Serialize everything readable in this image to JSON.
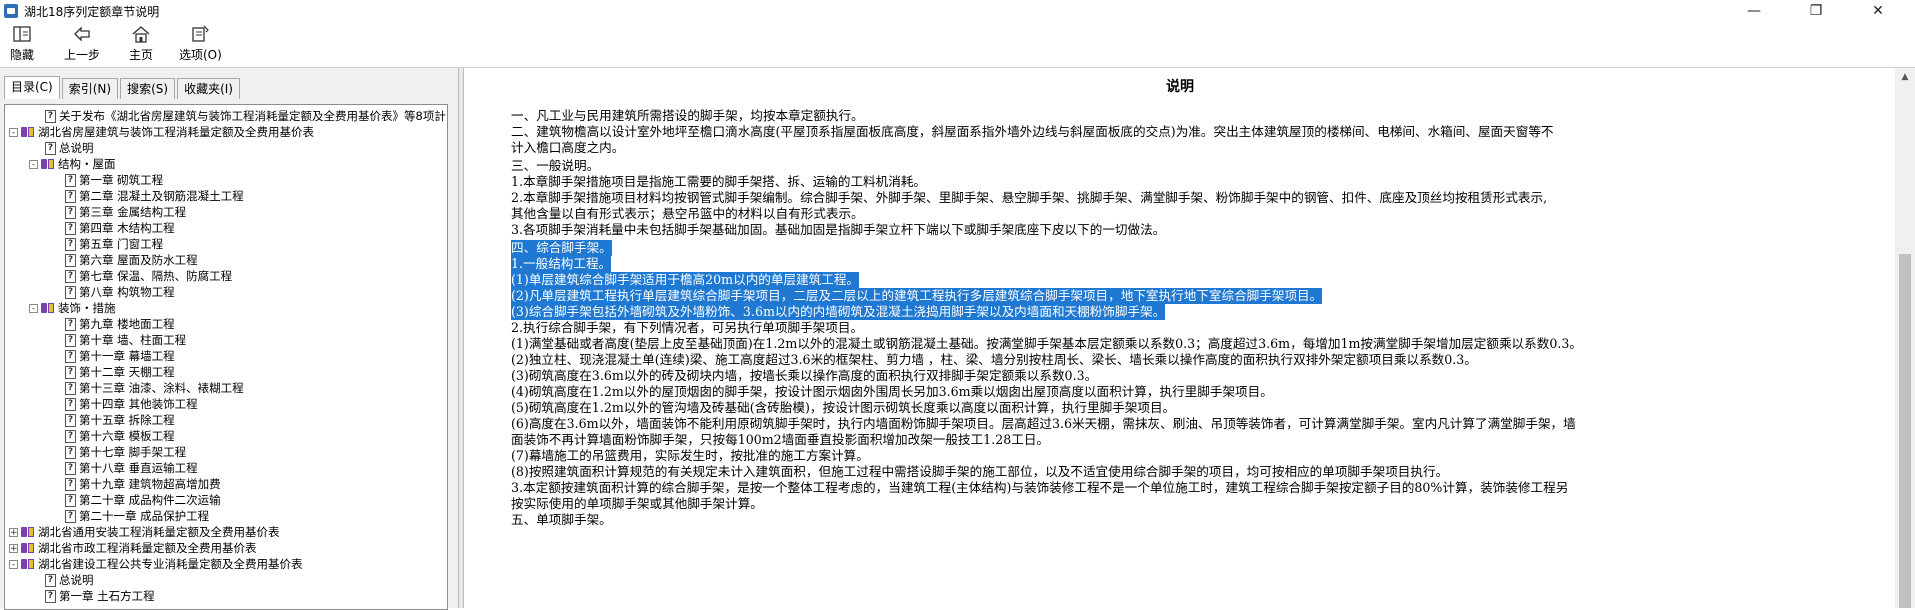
{
  "window": {
    "title": "湖北18序列定额章节说明"
  },
  "toolbar": {
    "buttons": [
      {
        "label": "隐藏",
        "icon": "hide-icon"
      },
      {
        "label": "上一步",
        "icon": "back-arrow-icon"
      },
      {
        "label": "主页",
        "icon": "home-icon"
      },
      {
        "label": "选项(O)",
        "icon": "options-icon"
      }
    ]
  },
  "tabs": [
    "目录(C)",
    "索引(N)",
    "搜索(S)",
    "收藏夹(I)"
  ],
  "tree": [
    {
      "text": "关于发布《湖北省房屋建筑与装饰工程消耗量定额及全费用基价表》等8项計",
      "type": "doc",
      "level": 1
    },
    {
      "text": "湖北省房屋建筑与装饰工程消耗量定额及全费用基价表",
      "type": "book",
      "level": 0,
      "toggle": "-"
    },
    {
      "text": "总说明",
      "type": "doc",
      "level": 1
    },
    {
      "text": "结构・屋面",
      "type": "book",
      "level": 1,
      "toggle": "-"
    },
    {
      "text": "第一章 砌筑工程",
      "type": "doc",
      "level": 2
    },
    {
      "text": "第二章 混凝土及钢筋混凝土工程",
      "type": "doc",
      "level": 2
    },
    {
      "text": "第三章 金属结构工程",
      "type": "doc",
      "level": 2
    },
    {
      "text": "第四章 木结构工程",
      "type": "doc",
      "level": 2
    },
    {
      "text": "第五章 门窗工程",
      "type": "doc",
      "level": 2
    },
    {
      "text": "第六章 屋面及防水工程",
      "type": "doc",
      "level": 2
    },
    {
      "text": "第七章 保温、隔热、防腐工程",
      "type": "doc",
      "level": 2
    },
    {
      "text": "第八章 构筑物工程",
      "type": "doc",
      "level": 2
    },
    {
      "text": "装饰・措施",
      "type": "book",
      "level": 1,
      "toggle": "-"
    },
    {
      "text": "第九章 楼地面工程",
      "type": "doc",
      "level": 2
    },
    {
      "text": "第十章 墙、柱面工程",
      "type": "doc",
      "level": 2
    },
    {
      "text": "第十一章 幕墙工程",
      "type": "doc",
      "level": 2
    },
    {
      "text": "第十二章 天棚工程",
      "type": "doc",
      "level": 2
    },
    {
      "text": "第十三章 油漆、涂料、裱糊工程",
      "type": "doc",
      "level": 2
    },
    {
      "text": "第十四章 其他装饰工程",
      "type": "doc",
      "level": 2
    },
    {
      "text": "第十五章 拆除工程",
      "type": "doc",
      "level": 2
    },
    {
      "text": "第十六章 模板工程",
      "type": "doc",
      "level": 2
    },
    {
      "text": "第十七章 脚手架工程",
      "type": "doc",
      "level": 2
    },
    {
      "text": "第十八章 垂直运输工程",
      "type": "doc",
      "level": 2
    },
    {
      "text": "第十九章 建筑物超高增加费",
      "type": "doc",
      "level": 2
    },
    {
      "text": "第二十章 成品构件二次运输",
      "type": "doc",
      "level": 2
    },
    {
      "text": "第二十一章 成品保护工程",
      "type": "doc",
      "level": 2
    },
    {
      "text": "湖北省通用安装工程消耗量定额及全费用基价表",
      "type": "book",
      "level": 0,
      "toggle": "+"
    },
    {
      "text": "湖北省市政工程消耗量定额及全费用基价表",
      "type": "book",
      "level": 0,
      "toggle": "+"
    },
    {
      "text": "湖北省建设工程公共专业消耗量定额及全费用基价表",
      "type": "book",
      "level": 0,
      "toggle": "-"
    },
    {
      "text": "总说明",
      "type": "doc",
      "level": 1
    },
    {
      "text": "第一章 土石方工程",
      "type": "doc",
      "level": 1
    }
  ],
  "content": {
    "heading": "说明",
    "lines": [
      {
        "text": "一、凡工业与民用建筑所需搭设的脚手架，均按本章定额执行。",
        "selected": false
      },
      {
        "text": "二、建筑物檐高以设计室外地坪至檐口滴水高度(平屋顶系指屋面板底高度，斜屋面系指外墙外边线与斜屋面板底的交点)为准。突出主体建筑屋顶的楼梯间、电梯间、水箱间、屋面天窗等不",
        "selected": false
      },
      {
        "text": "计入檐口高度之内。",
        "selected": false
      },
      {
        "text": "三、一般说明。",
        "selected": false
      },
      {
        "text": "1.本章脚手架措施项目是指施工需要的脚手架搭、拆、运输的工料机消耗。",
        "selected": false
      },
      {
        "text": "2.本章脚手架措施项目材料均按钢管式脚手架编制。综合脚手架、外脚手架、里脚手架、悬空脚手架、挑脚手架、满堂脚手架、粉饰脚手架中的钢管、扣件、底座及顶丝均按租赁形式表示,",
        "selected": false
      },
      {
        "text": "其他含量以自有形式表示；悬空吊篮中的材料以自有形式表示。",
        "selected": false
      },
      {
        "text": "3.各项脚手架消耗量中未包括脚手架基础加固。基础加固是指脚手架立杆下端以下或脚手架底座下皮以下的一切做法。",
        "selected": false
      },
      {
        "text": "四、综合脚手架。",
        "selected": true
      },
      {
        "text": "1.一般结构工程。",
        "selected": true
      },
      {
        "text": "(1)单层建筑综合脚手架适用于檐高20m以内的单层建筑工程。",
        "selected": true
      },
      {
        "text": "(2)凡单层建筑工程执行单层建筑综合脚手架项目，二层及二层以上的建筑工程执行多层建筑综合脚手架项目，地下室执行地下室综合脚手架项目。",
        "selected": true
      },
      {
        "text": "(3)综合脚手架包括外墙砌筑及外墙粉饰、3.6m以内的内墙砌筑及混凝土浇捣用脚手架以及内墙面和天棚粉饰脚手架。",
        "selected": true
      },
      {
        "text": "2.执行综合脚手架，有下列情况者，可另执行单项脚手架项目。",
        "selected": false
      },
      {
        "text": "(1)满堂基础或者高度(垫层上皮至基础顶面)在1.2m以外的混凝土或钢筋混凝土基础。按满堂脚手架基本层定额乘以系数0.3；高度超过3.6m，每增加1m按满堂脚手架增加层定额乘以系数0.3。",
        "selected": false
      },
      {
        "text": "(2)独立柱、现浇混凝土单(连续)梁、施工高度超过3.6米的框架柱、剪力墙 ，柱、梁、墙分别按柱周长、梁长、墙长乘以操作高度的面积执行双排外架定额项目乘以系数0.3。",
        "selected": false
      },
      {
        "text": "(3)砌筑高度在3.6m以外的砖及砌块内墙，按墙长乘以操作高度的面积执行双排脚手架定额乘以系数0.3。",
        "selected": false
      },
      {
        "text": "(4)砌筑高度在1.2m以外的屋顶烟囱的脚手架，按设计图示烟囱外围周长另加3.6m乘以烟囱出屋顶高度以面积计算，执行里脚手架项目。",
        "selected": false
      },
      {
        "text": "(5)砌筑高度在1.2m以外的管沟墙及砖基础(含砖胎模)，按设计图示砌筑长度乘以高度以面积计算，执行里脚手架项目。",
        "selected": false
      },
      {
        "text": "(6)高度在3.6m以外，墙面装饰不能利用原砌筑脚手架时，执行内墙面粉饰脚手架项目。层高超过3.6米天棚，需抹灰、刷油、吊顶等装饰者，可计算满堂脚手架。室内凡计算了满堂脚手架，墙",
        "selected": false
      },
      {
        "text": "面装饰不再计算墙面粉饰脚手架，只按每100m2墙面垂直投影面积增加改架一般技工1.28工日。",
        "selected": false
      },
      {
        "text": "(7)幕墙施工的吊篮费用，实际发生时，按批准的施工方案计算。",
        "selected": false
      },
      {
        "text": "(8)按照建筑面积计算规范的有关规定未计入建筑面积，但施工过程中需搭设脚手架的施工部位，以及不适宜使用综合脚手架的项目，均可按相应的单项脚手架项目执行。",
        "selected": false
      },
      {
        "text": "3.本定额按建筑面积计算的综合脚手架，是按一个整体工程考虑的，当建筑工程(主体结构)与装饰装修工程不是一个单位施工时，建筑工程综合脚手架按定额子目的80%计算，装饰装修工程另",
        "selected": false
      },
      {
        "text": "按实际使用的单项脚手架或其他脚手架计算。",
        "selected": false
      },
      {
        "text": "五、单项脚手架。",
        "selected": false
      }
    ]
  }
}
